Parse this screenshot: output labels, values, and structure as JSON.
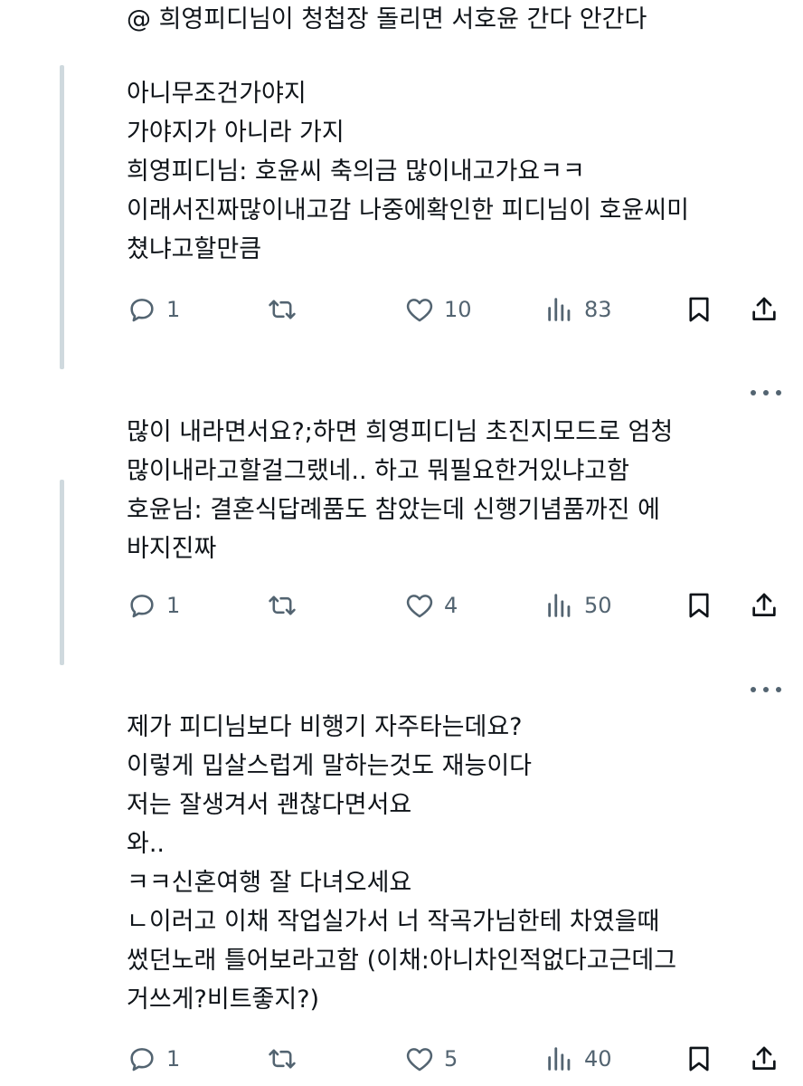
{
  "top_line": "@ 희영피디님이 청첩장 돌리면 서호윤 간다 안간다",
  "tweets": [
    {
      "lines": [
        "아니무조건가야지",
        "가야지가 아니라 가지",
        "희영피디님: 호윤씨 축의금 많이내고가요ㅋㅋ",
        "이래서진짜많이내고감 나중에확인한 피디님이 호윤씨미",
        "쳤냐고할만큼"
      ],
      "replies": "1",
      "likes": "10",
      "views": "83"
    },
    {
      "lines": [
        "많이 내라면서요?;하면 희영피디님 초진지모드로 엄청",
        "많이내라고할걸그랬네.. 하고 뭐필요한거있냐고함",
        "호윤님: 결혼식답례품도 참았는데 신행기념품까진 에",
        "바지진짜"
      ],
      "replies": "1",
      "likes": "4",
      "views": "50"
    },
    {
      "lines": [
        "제가 피디님보다 비행기 자주타는데요?",
        "이렇게 밉살스럽게 말하는것도 재능이다",
        "저는 잘생겨서 괜찮다면서요",
        "와..",
        "ㅋㅋ신혼여행 잘 다녀오세요",
        "ㄴ이러고 이채 작업실가서 너 작곡가님한테 차였을때",
        "썼던노래 틀어보라고함 (이채:아니차인적없다고근데그",
        "거쓰게?비트좋지?)"
      ],
      "replies": "1",
      "likes": "5",
      "views": "40"
    }
  ],
  "icons": {
    "reply": "reply-bubble-icon",
    "retweet": "retweet-icon",
    "like": "heart-icon",
    "views": "views-bar-chart-icon",
    "bookmark": "bookmark-icon",
    "share": "share-icon",
    "more": "more-dots-icon"
  },
  "colors": {
    "text": "#0f1419",
    "muted": "#536471",
    "thread_line": "#cfd9de"
  }
}
